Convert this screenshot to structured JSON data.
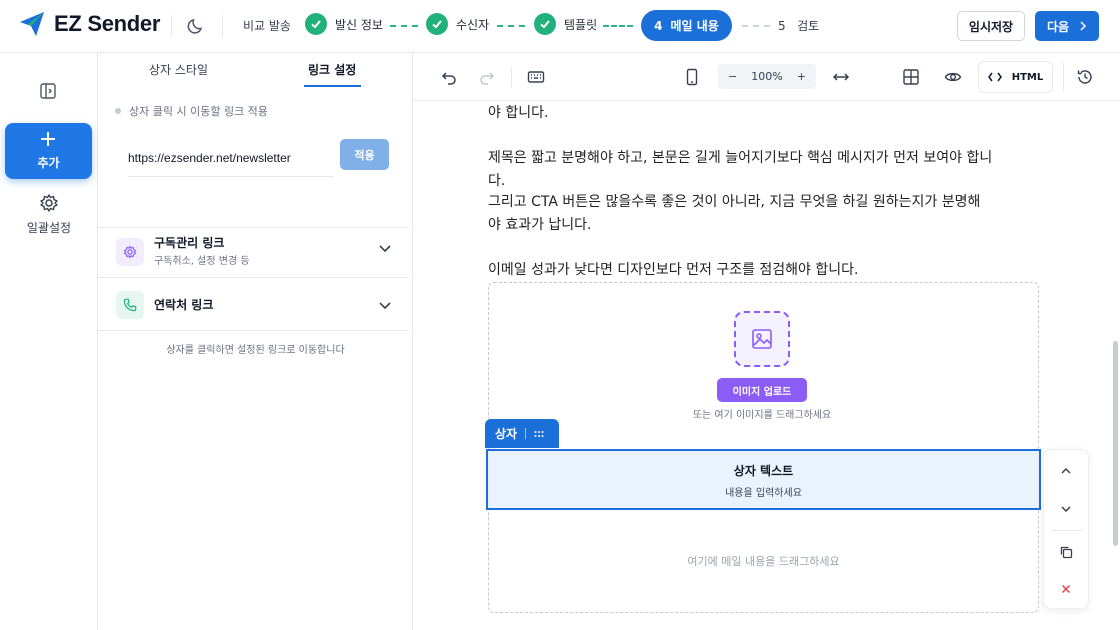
{
  "brand": {
    "name": "EZ Sender",
    "accent": "#1b6fd8",
    "success": "#22b07d",
    "purple": "#8b5cf6"
  },
  "header": {
    "compare_label": "비교 발송",
    "steps": [
      {
        "label": "발신 정보",
        "status": "done"
      },
      {
        "label": "수신자",
        "status": "done"
      },
      {
        "label": "템플릿",
        "status": "done"
      },
      {
        "number": "4",
        "label": "메일 내용",
        "status": "active"
      },
      {
        "number": "5",
        "label": "검토",
        "status": "pending"
      }
    ],
    "draft_label": "임시저장",
    "next_label": "다음"
  },
  "rail": {
    "add_label": "추가",
    "bulk_label": "일괄설정"
  },
  "panel": {
    "tabs": [
      "상자 스타일",
      "링크 설정"
    ],
    "active_tab": "링크 설정",
    "hint": "상자 클릭 시 이동할 링크 적용",
    "url_value": "https://ezsender.net/newsletter",
    "apply_label": "적용",
    "sections": [
      {
        "title": "구독관리 링크",
        "subtitle": "구독취소, 설정 변경 등",
        "icon": "gear-icon"
      },
      {
        "title": "연락처 링크",
        "subtitle": "",
        "icon": "phone-icon"
      }
    ],
    "footer": "상자를 클릭하면 설정된 링크로 이동합니다"
  },
  "toolbar": {
    "zoom": "100%",
    "html_label": "HTML"
  },
  "content": {
    "line1": "야 합니다.",
    "para2_line1": "제목은 짧고 분명해야 하고, 본문은 길게 늘어지기보다 핵심 메시지가 먼저 보여야 합니",
    "para2_line2": "다.",
    "para2_line3": "그리고 CTA 버튼은 많을수록 좋은 것이 아니라, 지금 무엇을 하길 원하는지가 분명해",
    "para2_line4": "야 효과가 납니다.",
    "para3": "이메일 성과가 낮다면 디자인보다 먼저 구조를 점검해야 합니다.",
    "upload_label": "이미지 업로드",
    "drag_hint": "또는 여기 이미지를 드래그하세요",
    "box_tag": "상자",
    "box_title": "상자 텍스트",
    "box_placeholder": "내용을 입력하세요",
    "drop_message": "여기에 메일 내용을 드래그하세요"
  }
}
